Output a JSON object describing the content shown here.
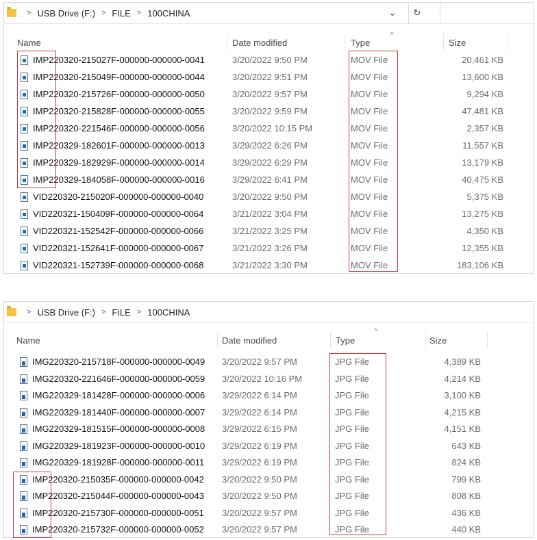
{
  "panels": [
    {
      "breadcrumb": [
        "USB Drive (F:)",
        "FILE",
        "100CHINA"
      ],
      "columns": {
        "name": "Name",
        "date": "Date modified",
        "type": "Type",
        "size": "Size"
      },
      "rows": [
        {
          "name": "IMP220320-215027F-000000-000000-0041",
          "date": "3/20/2022 9:50 PM",
          "type": "MOV File",
          "size": "20,461 KB"
        },
        {
          "name": "IMP220320-215049F-000000-000000-0044",
          "date": "3/20/2022 9:51 PM",
          "type": "MOV File",
          "size": "13,600 KB"
        },
        {
          "name": "IMP220320-215726F-000000-000000-0050",
          "date": "3/20/2022 9:57 PM",
          "type": "MOV File",
          "size": "9,294 KB"
        },
        {
          "name": "IMP220320-215828F-000000-000000-0055",
          "date": "3/20/2022 9:59 PM",
          "type": "MOV File",
          "size": "47,481 KB"
        },
        {
          "name": "IMP220320-221546F-000000-000000-0056",
          "date": "3/20/2022 10:15 PM",
          "type": "MOV File",
          "size": "2,357 KB"
        },
        {
          "name": "IMP220329-182601F-000000-000000-0013",
          "date": "3/29/2022 6:26 PM",
          "type": "MOV File",
          "size": "11,557 KB"
        },
        {
          "name": "IMP220329-182929F-000000-000000-0014",
          "date": "3/29/2022 6:29 PM",
          "type": "MOV File",
          "size": "13,179 KB"
        },
        {
          "name": "IMP220329-184058F-000000-000000-0016",
          "date": "3/29/2022 6:41 PM",
          "type": "MOV File",
          "size": "40,475 KB"
        },
        {
          "name": "VID220320-215020F-000000-000000-0040",
          "date": "3/20/2022 9:50 PM",
          "type": "MOV File",
          "size": "5,375 KB"
        },
        {
          "name": "VID220321-150409F-000000-000000-0064",
          "date": "3/21/2022 3:04 PM",
          "type": "MOV File",
          "size": "13,275 KB"
        },
        {
          "name": "VID220321-152542F-000000-000000-0066",
          "date": "3/21/2022 3:25 PM",
          "type": "MOV File",
          "size": "4,350 KB"
        },
        {
          "name": "VID220321-152641F-000000-000000-0067",
          "date": "3/21/2022 3:26 PM",
          "type": "MOV File",
          "size": "12,355 KB"
        },
        {
          "name": "VID220321-152739F-000000-000000-0068",
          "date": "3/21/2022 3:30 PM",
          "type": "MOV File",
          "size": "183,106 KB"
        }
      ]
    },
    {
      "breadcrumb": [
        "USB Drive (F:)",
        "FILE",
        "100CHINA"
      ],
      "columns": {
        "name": "Name",
        "date": "Date modified",
        "type": "Type",
        "size": "Size"
      },
      "rows": [
        {
          "name": "IMG220320-215718F-000000-000000-0049",
          "date": "3/20/2022 9:57 PM",
          "type": "JPG File",
          "size": "4,389 KB"
        },
        {
          "name": "IMG220320-221646F-000000-000000-0059",
          "date": "3/20/2022 10:16 PM",
          "type": "JPG File",
          "size": "4,214 KB"
        },
        {
          "name": "IMG220329-181428F-000000-000000-0006",
          "date": "3/29/2022 6:14 PM",
          "type": "JPG File",
          "size": "3,100 KB"
        },
        {
          "name": "IMG220329-181440F-000000-000000-0007",
          "date": "3/29/2022 6:14 PM",
          "type": "JPG File",
          "size": "4,215 KB"
        },
        {
          "name": "IMG220329-181515F-000000-000000-0008",
          "date": "3/29/2022 6:15 PM",
          "type": "JPG File",
          "size": "4,151 KB"
        },
        {
          "name": "IMG220329-181923F-000000-000000-0010",
          "date": "3/29/2022 6:19 PM",
          "type": "JPG File",
          "size": "643 KB"
        },
        {
          "name": "IMG220329-181928F-000000-000000-0011",
          "date": "3/29/2022 6:19 PM",
          "type": "JPG File",
          "size": "824 KB"
        },
        {
          "name": "IMP220320-215035F-000000-000000-0042",
          "date": "3/20/2022 9:50 PM",
          "type": "JPG File",
          "size": "799 KB"
        },
        {
          "name": "IMP220320-215044F-000000-000000-0043",
          "date": "3/20/2022 9:50 PM",
          "type": "JPG File",
          "size": "808 KB"
        },
        {
          "name": "IMP220320-215730F-000000-000000-0051",
          "date": "3/20/2022 9:57 PM",
          "type": "JPG File",
          "size": "436 KB"
        },
        {
          "name": "IMP220320-215732F-000000-000000-0052",
          "date": "3/20/2022 9:57 PM",
          "type": "JPG File",
          "size": "440 KB"
        }
      ]
    }
  ],
  "icons": {
    "folder": "folder-icon",
    "separator": "chevron-right-icon",
    "dropdown": "chevron-down-icon",
    "refresh": "refresh-icon",
    "sort": "sort-ascending-icon",
    "mov_file": "video-file-icon",
    "jpg_file": "image-file-icon"
  },
  "colors": {
    "highlight_box": "#c83a3a",
    "folder": "#f5c242",
    "file_icon": "#1f6fb5"
  }
}
